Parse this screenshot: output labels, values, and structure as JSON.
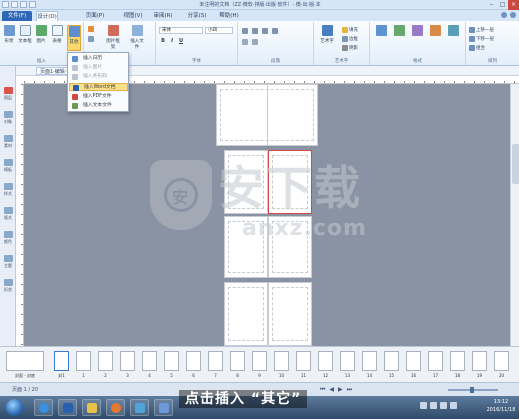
{
  "window": {
    "title": "未注明的文档（ZZ·微软·排版·出版·软件）- 微·出·版·本",
    "minimize": "–",
    "maximize": "□",
    "close": "×"
  },
  "tabs": [
    {
      "label": "文件(F)"
    },
    {
      "label": "设计(D)"
    },
    {
      "label": "页面(P)"
    },
    {
      "label": "视图(V)"
    },
    {
      "label": "审阅(R)"
    },
    {
      "label": "分享(S)"
    },
    {
      "label": "帮助(H)"
    }
  ],
  "ribbon": {
    "groups": {
      "insert": "插入",
      "font": "字体",
      "paragraph": "段落",
      "artword": "艺术字",
      "format": "格式",
      "arrange": "排列"
    },
    "buttons": {
      "draw": "形状",
      "textbox": "文本框",
      "image": "图片",
      "table": "表格",
      "other": "其他",
      "picture_frame": "图片框架",
      "insert_file": "插入文件",
      "font_name": "宋体",
      "font_size": "小四",
      "bold": "B",
      "italic": "I",
      "underline": "U",
      "artword": "艺术字",
      "fill": "填充",
      "line": "边框",
      "shadow": "阴影",
      "forward": "上移一层",
      "backward": "下移一层",
      "group": "组合",
      "align": "对齐"
    }
  },
  "menu": {
    "items": [
      {
        "label": "插入日历",
        "state": "normal"
      },
      {
        "label": "插入图片",
        "state": "disabled"
      },
      {
        "label": "插入条形码",
        "state": "disabled"
      },
      {
        "label": "插入Word文档",
        "state": "highlighted"
      },
      {
        "label": "插入PDF文件",
        "state": "normal"
      },
      {
        "label": "插入文本文件",
        "state": "normal"
      }
    ]
  },
  "document": {
    "tab": "页面1·编辑·计划"
  },
  "rail": {
    "items": [
      {
        "label": "图层"
      },
      {
        "label": "对象"
      },
      {
        "label": "素材"
      },
      {
        "label": "模板"
      },
      {
        "label": "样式"
      },
      {
        "label": "版式"
      },
      {
        "label": "颜色"
      },
      {
        "label": "主题"
      },
      {
        "label": "形状"
      }
    ]
  },
  "watermark": {
    "shield_char": "安",
    "big": "安下载",
    "url": "anxz.com"
  },
  "thumbnails": [
    {
      "label": "封面 - 封底"
    },
    {
      "label": "封1"
    },
    {
      "label": "1"
    },
    {
      "label": "2"
    },
    {
      "label": "3"
    },
    {
      "label": "4"
    },
    {
      "label": "5"
    },
    {
      "label": "6"
    },
    {
      "label": "7"
    },
    {
      "label": "8"
    },
    {
      "label": "9"
    },
    {
      "label": "10"
    },
    {
      "label": "11"
    },
    {
      "label": "12"
    },
    {
      "label": "13"
    },
    {
      "label": "14"
    },
    {
      "label": "15"
    },
    {
      "label": "16"
    },
    {
      "label": "17"
    },
    {
      "label": "18"
    },
    {
      "label": "19"
    },
    {
      "label": "20"
    }
  ],
  "status": {
    "page_info": "页面 1 / 20",
    "nav_first": "⏮",
    "nav_prev": "◀",
    "nav_next": "▶",
    "nav_last": "⏭"
  },
  "caption": "点击插入 “其它”",
  "clock": {
    "time": "13:12",
    "date": "2016/11/18"
  },
  "colors": {
    "accent": "#2f67b8",
    "workspace": "#8a93a3",
    "highlight": "#fbe08a",
    "selected_page": "#d84848"
  }
}
